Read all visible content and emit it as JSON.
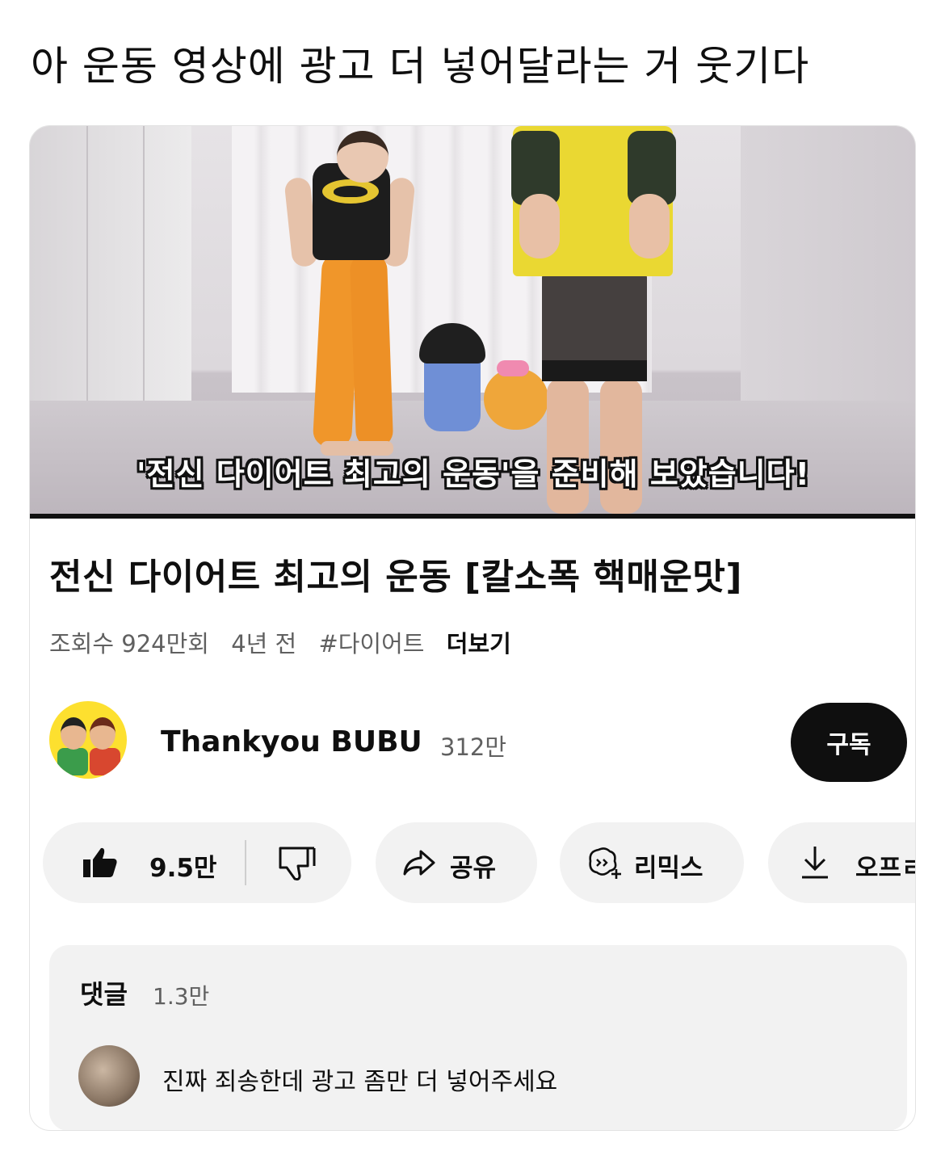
{
  "post": {
    "text": "아 운동 영상에 광고 더 넣어달라는 거 웃기다"
  },
  "video": {
    "subtitle": "'전신 다이어트 최고의 운동'을 준비해 보았습니다!",
    "title": "전신 다이어트 최고의 운동 [칼소폭 핵매운맛]",
    "views": "조회수 924만회",
    "age": "4년 전",
    "hashtag": "#다이어트",
    "more": "더보기"
  },
  "channel": {
    "name": "Thankyou BUBU",
    "subscribers": "312만",
    "subscribe_label": "구독"
  },
  "actions": {
    "like_count": "9.5만",
    "share_label": "공유",
    "remix_label": "리믹스",
    "offline_label": "오프ㄹ"
  },
  "comments": {
    "header": "댓글",
    "count": "1.3만",
    "top_comment": "진짜 죄송한데 광고 좀만 더 넣어주세요"
  },
  "colors": {
    "subscribe_bg": "#0f0f0f",
    "pill_bg": "#f2f2f2",
    "secondary_text": "#606060"
  },
  "icons": [
    "thumbs-up-icon",
    "thumbs-down-icon",
    "share-icon",
    "remix-icon",
    "download-icon"
  ]
}
